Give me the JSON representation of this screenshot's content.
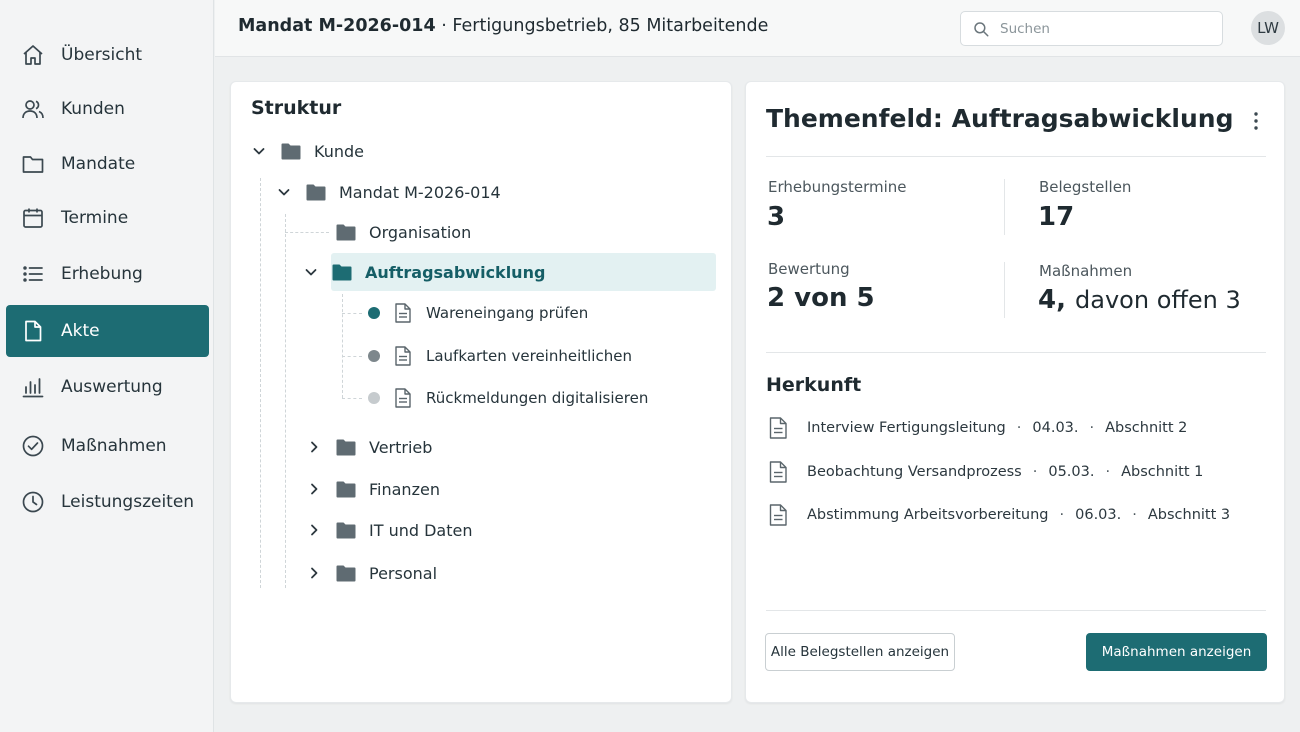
{
  "sidebar": {
    "items": [
      {
        "label": "Übersicht",
        "icon": "home-icon"
      },
      {
        "label": "Kunden",
        "icon": "users-icon"
      },
      {
        "label": "Mandate",
        "icon": "folder-icon"
      },
      {
        "label": "Termine",
        "icon": "calendar-icon"
      },
      {
        "label": "Erhebung",
        "icon": "list-icon"
      },
      {
        "label": "Akte",
        "icon": "document-icon",
        "active": true
      },
      {
        "label": "Auswertung",
        "icon": "bar-chart-icon"
      },
      {
        "label": "Maßnahmen",
        "icon": "check-circle-icon"
      },
      {
        "label": "Leistungszeiten",
        "icon": "clock-icon"
      }
    ]
  },
  "header": {
    "mandate": "Mandat M-2026-014",
    "separator": "·",
    "description": "Fertigungsbetrieb, 85 Mitarbeitende",
    "search_placeholder": "Suchen",
    "search_value": "",
    "avatar_initials": "LW"
  },
  "tree": {
    "title": "Struktur",
    "nodes": [
      {
        "label": "Kunde",
        "type": "folder",
        "expanded": true
      },
      {
        "label": "Mandat M-2026-014",
        "type": "folder",
        "expanded": true
      },
      {
        "label": "Organisation",
        "type": "folder"
      },
      {
        "label": "Auftragsabwicklung",
        "type": "folder",
        "expanded": true,
        "selected": true
      },
      {
        "label": "Wareneingang prüfen",
        "type": "document",
        "status": "complete"
      },
      {
        "label": "Laufkarten vereinheitlichen",
        "type": "document",
        "status": "in-progress"
      },
      {
        "label": "Rückmeldungen digitalisieren",
        "type": "document",
        "status": "open"
      },
      {
        "label": "Vertrieb",
        "type": "folder",
        "expanded": false
      },
      {
        "label": "Finanzen",
        "type": "folder",
        "expanded": false
      },
      {
        "label": "IT und Daten",
        "type": "folder",
        "expanded": false
      },
      {
        "label": "Personal",
        "type": "folder",
        "expanded": false
      }
    ]
  },
  "detail": {
    "title": "Themenfeld: Auftragsabwicklung",
    "stats": {
      "erhebungstermine": {
        "label": "Erhebungstermine",
        "value": "3"
      },
      "belegstellen": {
        "label": "Belegstellen",
        "value": "17"
      },
      "bewertung": {
        "label": "Bewertung",
        "value": "2 von 5"
      },
      "massnahmen": {
        "label": "Maßnahmen",
        "value_main": "4,",
        "value_rest": "davon offen 3"
      }
    },
    "herkunft_title": "Herkunft",
    "sources": [
      {
        "name": "Interview Fertigungsleitung",
        "date": "04.03.",
        "section": "Abschnitt 2"
      },
      {
        "name": "Beobachtung Versandprozess",
        "date": "05.03.",
        "section": "Abschnitt 1"
      },
      {
        "name": "Abstimmung Arbeitsvorbereitung",
        "date": "06.03.",
        "section": "Abschnitt 3"
      }
    ],
    "dot_separator": "·",
    "buttons": {
      "all_sources": "Alle Belegstellen anzeigen",
      "show_measures": "Maßnahmen anzeigen"
    }
  },
  "colors": {
    "accent": "#1d6c73",
    "folder": "#5f6b72",
    "folder_selected": "#1d6c73",
    "status_complete": "#1d6c73",
    "status_in_progress": "#7d878c",
    "status_open": "#c6cbce"
  }
}
